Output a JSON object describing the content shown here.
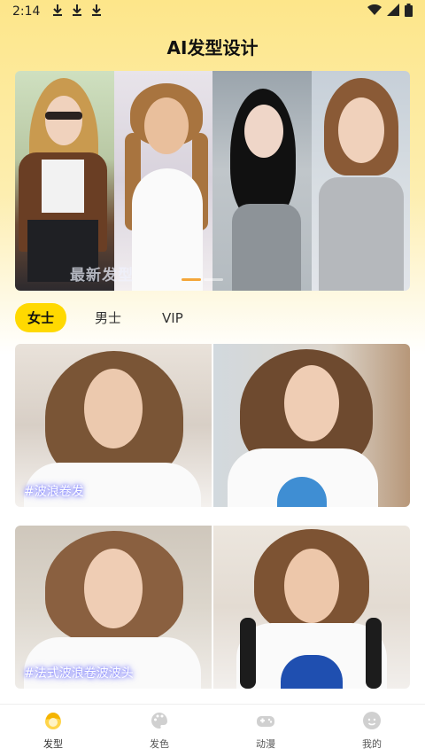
{
  "status_bar": {
    "time": "2:14"
  },
  "app": {
    "title": "AI发型设计"
  },
  "banner": {
    "watermark": "最新发型"
  },
  "tabs": [
    {
      "label": "女士",
      "active": true
    },
    {
      "label": "男士",
      "active": false
    },
    {
      "label": "VIP",
      "active": false
    }
  ],
  "cards": [
    {
      "tag": "#波浪卷发"
    },
    {
      "tag": "#法式波浪卷波波头"
    }
  ],
  "bottom_nav": [
    {
      "label": "发型",
      "icon": "hairstyle-icon",
      "active": true
    },
    {
      "label": "发色",
      "icon": "palette-icon",
      "active": false
    },
    {
      "label": "动漫",
      "icon": "gamepad-icon",
      "active": false
    },
    {
      "label": "我的",
      "icon": "profile-icon",
      "active": false
    }
  ],
  "colors": {
    "accent": "#ffd900",
    "background_top": "#fde68a",
    "active_dot": "#f4a63a"
  }
}
